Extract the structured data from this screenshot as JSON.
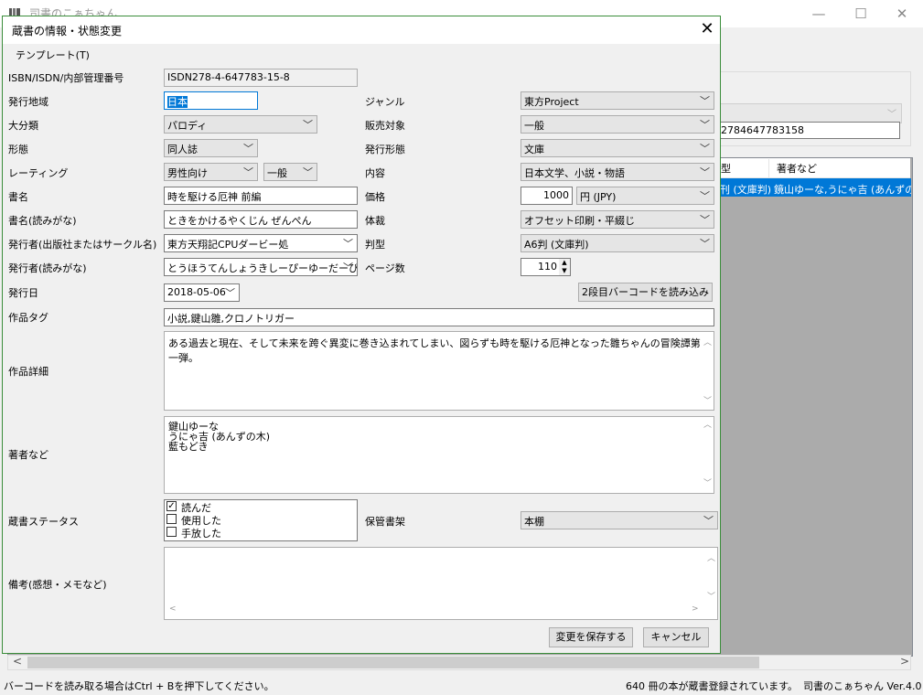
{
  "main_window": {
    "title": "司書のこぁちゃん",
    "controls": {
      "minimize": "—",
      "maximize": "☐",
      "close": "✕"
    },
    "bg_isbn_value": "2784647783158",
    "list_columns": [
      "型",
      "著者など"
    ],
    "list_row": [
      "刊 (文庫判)",
      "鏡山ゆーな,うにゃ吉 (あんずの木"
    ]
  },
  "status": {
    "hint": "バーコードを読み取る場合はCtrl + Bを押下してください。",
    "count": "640 冊の本が蔵書登録されています。",
    "app_version": "司書のこぁちゃん Ver.4.0"
  },
  "dialog": {
    "title": "蔵書の情報・状態変更",
    "close": "✕",
    "menu_template": "テンプレート(T)",
    "labels": {
      "isbn": "ISBN/ISDN/内部管理番号",
      "region": "発行地域",
      "category": "大分類",
      "form": "形態",
      "rating": "レーティング",
      "title": "書名",
      "title_kana": "書名(読みがな)",
      "publisher": "発行者(出版社またはサークル名)",
      "publisher_kana": "発行者(読みがな)",
      "date": "発行日",
      "tags": "作品タグ",
      "details": "作品詳細",
      "authors": "著者など",
      "status": "蔵書ステータス",
      "notes": "備考(感想・メモなど)",
      "genre": "ジャンル",
      "target": "販売対象",
      "pub_form": "発行形態",
      "content": "内容",
      "price": "価格",
      "binding": "体裁",
      "size": "判型",
      "pages": "ページ数",
      "shelf": "保管書架"
    },
    "values": {
      "isbn": "ISDN278-4-647783-15-8",
      "region": "日本",
      "category": "パロディ",
      "form": "同人誌",
      "rating": "男性向け",
      "rating_sub": "一般",
      "title": "時を駆ける厄神 前編",
      "title_kana": "ときをかけるやくじん ぜんぺん",
      "publisher": "東方天翔記CPUダービー処",
      "publisher_kana": "とうほうてんしょうきしーぴーゆーだーびーど",
      "date": "2018-05-06",
      "tags": "小説,鍵山雛,クロノトリガー",
      "details": "ある過去と現在、そして未来を跨ぐ異変に巻き込まれてしまい、図らずも時を駆ける厄神となった雛ちゃんの冒険譚第一弾。",
      "authors": [
        "鍵山ゆーな",
        "うにゃ吉 (あんずの木)",
        "藍もどき"
      ],
      "genre": "東方Project",
      "target": "一般",
      "pub_form": "文庫",
      "content": "日本文学、小説・物語",
      "price": "1000",
      "currency": "円 (JPY)",
      "binding": "オフセット印刷・平綴じ",
      "size": "A6判 (文庫判)",
      "pages": "110",
      "shelf": "本棚",
      "notes": ""
    },
    "status_options": [
      {
        "label": "読んだ",
        "checked": true
      },
      {
        "label": "使用した",
        "checked": false
      },
      {
        "label": "手放した",
        "checked": false
      }
    ],
    "buttons": {
      "barcode": "2段目バーコードを読み込み",
      "save": "変更を保存する",
      "cancel": "キャンセル"
    }
  }
}
